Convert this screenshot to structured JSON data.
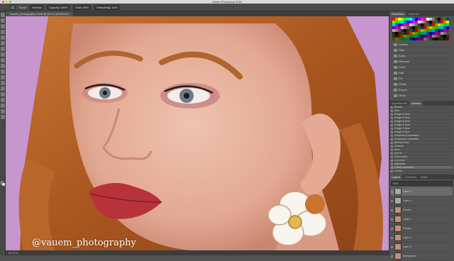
{
  "window": {
    "title": "Adobe Photoshop 2020"
  },
  "options_bar": {
    "tool": "Brush",
    "mode": "Normal",
    "opacity": "Opacity: 100%",
    "flow": "Flow: 35%",
    "smoothing": "Smoothing: 10%"
  },
  "document": {
    "tab": "vauem_photography 10.tif @ 66.7% (RGB/16*)",
    "status": "66.67%"
  },
  "watermark": "@vauem_photography",
  "right_panel": {
    "swatch_tabs": [
      "Swatches",
      "Libraries"
    ],
    "library_items": [
      "Lashes",
      "Skin",
      "Eyes",
      "Retouch",
      "Color",
      "Hair",
      "Fix",
      "Grade",
      "Export",
      "Other"
    ],
    "adjust_tabs": [
      "Adjustments",
      "Actions"
    ],
    "adjust_items": [
      "Beauty",
      "Skin",
      "Dodge & Burn",
      "Dodge & Burn",
      "Dodge & Burn",
      "Dodge & Burn",
      "Dodge & Burn",
      "Dodge & Burn",
      "Frequency Separation",
      "Frequency Separation",
      "Blemish fixes",
      "Shadow",
      "Eyes",
      "Eye fix",
      "Eyes colour",
      "Lip colour",
      "Highlights",
      "Colour correction",
      "Curves"
    ],
    "layers_tabs": [
      "Layers",
      "Channels",
      "Paths"
    ],
    "layers_search": "Kind",
    "blend_mode": "Normal",
    "opacity": "Opacity: 100%",
    "layers": [
      "Layer 3",
      "Layer 2",
      "Curves",
      "Layer 1",
      "Group 1",
      "Layer 0",
      "Layer 0",
      "Background"
    ]
  },
  "colors": {
    "canvas_bg": "#c796ce",
    "hair": "#b8642c",
    "skin": "#e8b4a0",
    "lips": "#b8323a",
    "eye": "#6a7a86"
  }
}
